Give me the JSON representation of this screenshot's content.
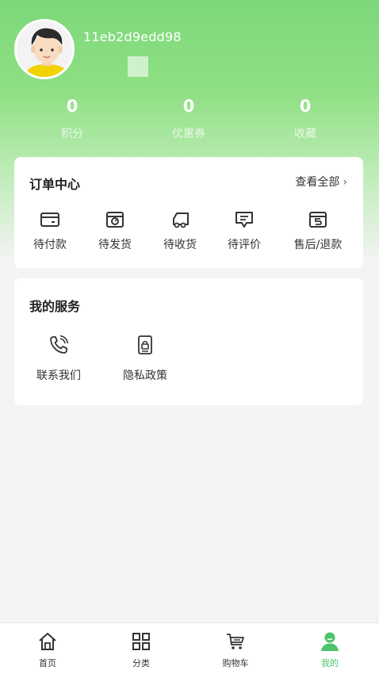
{
  "profile": {
    "username": "11eb2d9edd98"
  },
  "stats": [
    {
      "value": "0",
      "label": "积分"
    },
    {
      "value": "0",
      "label": "优惠券"
    },
    {
      "value": "0",
      "label": "收藏"
    }
  ],
  "orders": {
    "title": "订单中心",
    "view_all": "查看全部",
    "items": [
      {
        "label": "待付款",
        "icon": "wallet-icon"
      },
      {
        "label": "待发货",
        "icon": "box-icon"
      },
      {
        "label": "待收货",
        "icon": "truck-icon"
      },
      {
        "label": "待评价",
        "icon": "comment-icon"
      },
      {
        "label": "售后/退款",
        "icon": "refund-icon"
      }
    ]
  },
  "services": {
    "title": "我的服务",
    "items": [
      {
        "label": "联系我们",
        "icon": "phone-icon"
      },
      {
        "label": "隐私政策",
        "icon": "privacy-icon"
      }
    ]
  },
  "tabbar": {
    "items": [
      {
        "label": "首页",
        "icon": "home-icon"
      },
      {
        "label": "分类",
        "icon": "grid-icon"
      },
      {
        "label": "购物车",
        "icon": "cart-icon"
      },
      {
        "label": "我的",
        "icon": "user-icon"
      }
    ],
    "active_index": 3,
    "active_color": "#4cc46a"
  },
  "colors": {
    "brand_green": "#7cd97a",
    "active_tab": "#4cc46a"
  }
}
